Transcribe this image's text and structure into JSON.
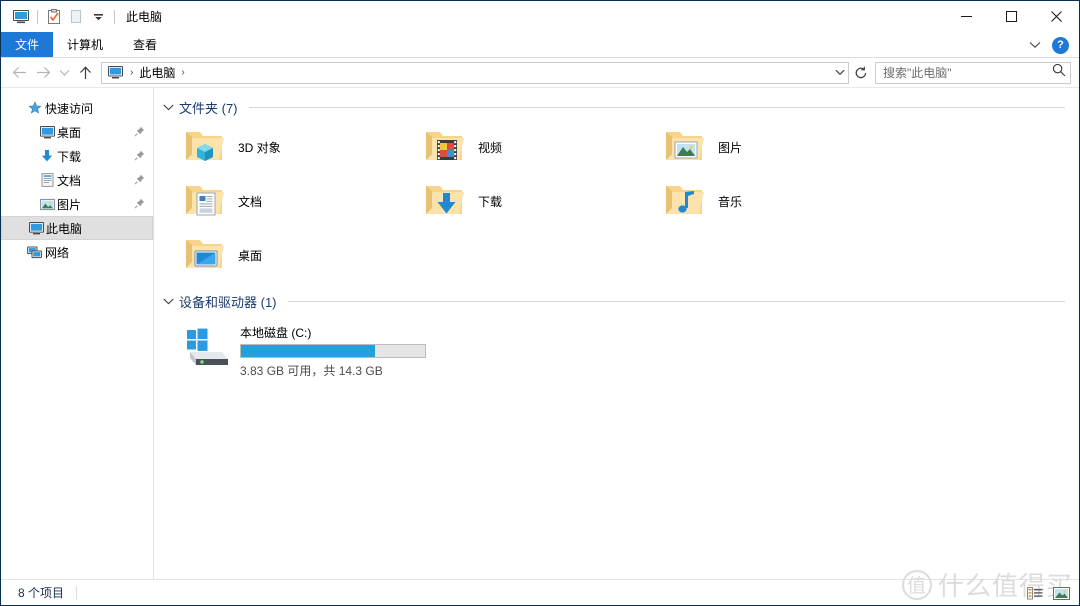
{
  "window": {
    "title": "此电脑",
    "quick_access": [
      {
        "name": "this-pc-icon",
        "label": "此电脑"
      },
      {
        "name": "properties-icon",
        "label": "属性"
      },
      {
        "name": "new-folder-icon",
        "label": "新建文件夹"
      },
      {
        "name": "customize-chevron-icon",
        "label": "自定义快速访问工具栏"
      }
    ],
    "controls": {
      "minimize": "—",
      "maximize": "□",
      "close": "✕"
    }
  },
  "ribbon": {
    "tabs": [
      {
        "label": "文件",
        "active": true
      },
      {
        "label": "计算机",
        "active": false
      },
      {
        "label": "查看",
        "active": false
      }
    ],
    "collapse_icon": "chevron-down-icon",
    "help_label": "?"
  },
  "address": {
    "back_icon": "←",
    "forward_icon": "→",
    "recent_icon": "⌄",
    "up_icon": "↑",
    "crumb_icon": "this-pc-icon",
    "crumbs": [
      "此电脑"
    ],
    "separator": "›",
    "dropdown_icon": "⌄",
    "refresh_icon": "↻"
  },
  "search": {
    "placeholder": "搜索\"此电脑\"",
    "icon": "search-icon"
  },
  "sidebar": {
    "items": [
      {
        "label": "快速访问",
        "icon": "star-pin-icon",
        "level": 0,
        "selected": false,
        "pinned": false
      },
      {
        "label": "桌面",
        "icon": "desktop-icon",
        "level": 1,
        "selected": false,
        "pinned": true
      },
      {
        "label": "下载",
        "icon": "download-icon",
        "level": 1,
        "selected": false,
        "pinned": true
      },
      {
        "label": "文档",
        "icon": "documents-icon",
        "level": 1,
        "selected": false,
        "pinned": true
      },
      {
        "label": "图片",
        "icon": "pictures-icon",
        "level": 1,
        "selected": false,
        "pinned": true
      },
      {
        "label": "此电脑",
        "icon": "this-pc-icon",
        "level": 0,
        "selected": true,
        "pinned": false
      },
      {
        "label": "网络",
        "icon": "network-icon",
        "level": 0,
        "selected": false,
        "pinned": false
      }
    ]
  },
  "main": {
    "folders_group": {
      "title": "文件夹 (7)",
      "chevron": "⌄",
      "items": [
        {
          "label": "3D 对象",
          "icon": "folder-3d-objects-icon"
        },
        {
          "label": "视频",
          "icon": "folder-videos-icon"
        },
        {
          "label": "图片",
          "icon": "folder-pictures-icon"
        },
        {
          "label": "文档",
          "icon": "folder-documents-icon"
        },
        {
          "label": "下载",
          "icon": "folder-downloads-icon"
        },
        {
          "label": "音乐",
          "icon": "folder-music-icon"
        },
        {
          "label": "桌面",
          "icon": "folder-desktop-icon"
        }
      ]
    },
    "devices_group": {
      "title": "设备和驱动器 (1)",
      "chevron": "⌄",
      "drives": [
        {
          "name": "本地磁盘 (C:)",
          "icon": "windows-drive-icon",
          "capacity_text": "3.83 GB 可用，共 14.3 GB",
          "used_percent": 73,
          "bar_color": "#26a0da",
          "bar_track_color": "#e6e6e6"
        }
      ]
    }
  },
  "statusbar": {
    "item_count": "8 个项目",
    "view_buttons": [
      {
        "name": "details-view-button",
        "label": "详细信息"
      },
      {
        "name": "large-icons-view-button",
        "label": "大图标"
      }
    ]
  },
  "watermark": {
    "mark": "值",
    "text": "什么值得买"
  },
  "colors": {
    "accent": "#1e78d7",
    "selection": "#e0e0e0",
    "group_title": "#1a3a6b",
    "drive_bar": "#26a0da"
  }
}
